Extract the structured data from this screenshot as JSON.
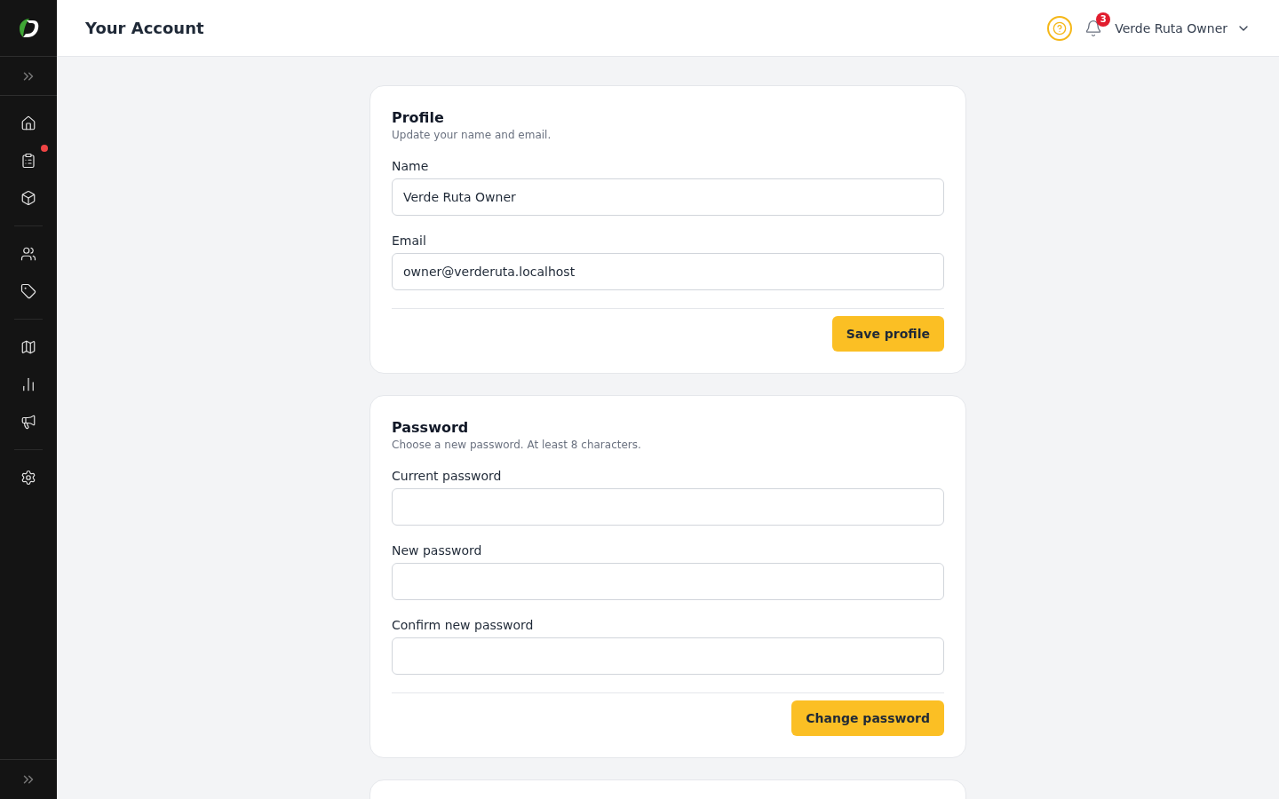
{
  "header": {
    "title": "Your Account",
    "notifications": "3",
    "user": "Verde Ruta Owner"
  },
  "sidebar": {
    "groups": [
      [
        {
          "has_dot": false
        },
        {
          "has_dot": true
        },
        {
          "has_dot": false
        }
      ],
      [
        {
          "has_dot": false
        },
        {
          "has_dot": false
        }
      ],
      [
        {
          "has_dot": false
        },
        {
          "has_dot": false
        },
        {
          "has_dot": false
        }
      ],
      [
        {
          "has_dot": false
        }
      ]
    ]
  },
  "cards": [
    {
      "title": "Profile",
      "subtitle": "Update your name and email.",
      "fields": [
        {
          "label": "Name",
          "value": "Verde Ruta Owner"
        },
        {
          "label": "Email",
          "value": "owner@verderuta.localhost"
        }
      ],
      "button": "Save profile"
    },
    {
      "title": "Password",
      "subtitle": "Choose a new password. At least 8 characters.",
      "fields": [
        {
          "label": "Current password"
        },
        {
          "label": "New password"
        },
        {
          "label": "Confirm new password"
        }
      ],
      "button": "Change password"
    }
  ]
}
